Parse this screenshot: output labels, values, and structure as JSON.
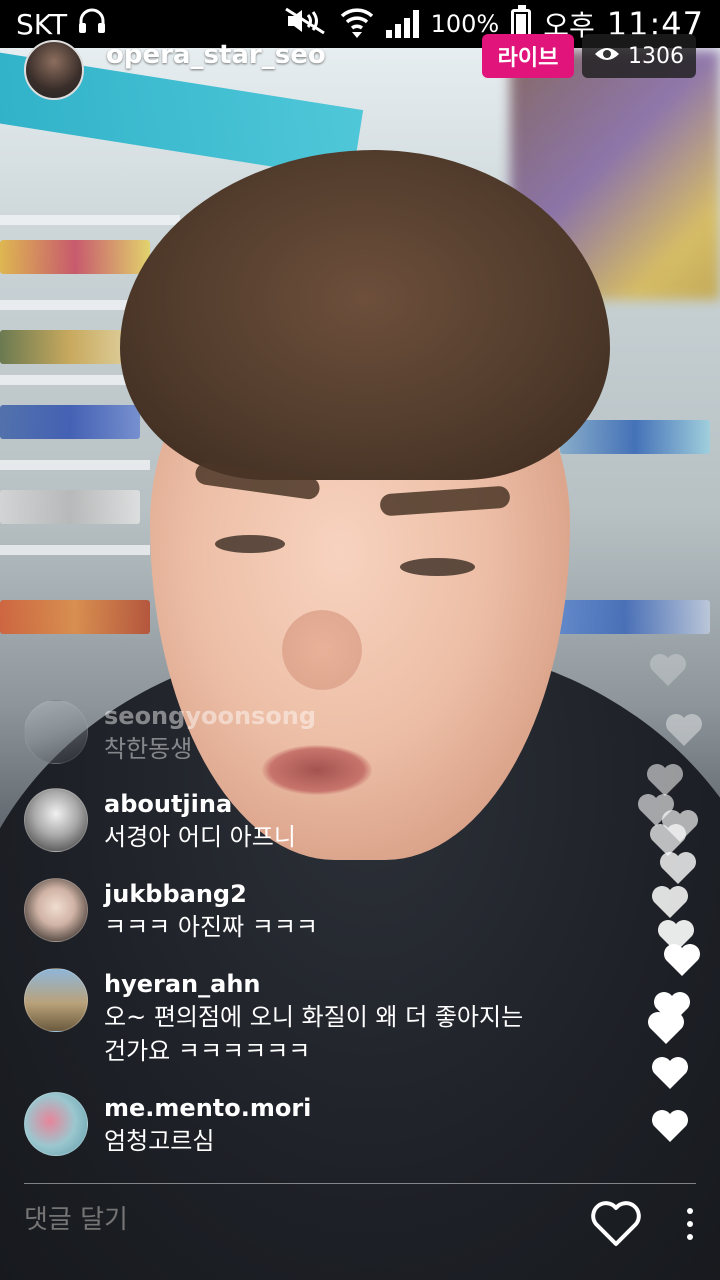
{
  "status_bar": {
    "carrier": "SKT",
    "battery_percent": "100%",
    "ampm": "오후",
    "time": "11:47"
  },
  "header": {
    "host_username": "opera_star_seo",
    "live_label": "라이브",
    "viewer_count": "1306"
  },
  "comments": [
    {
      "username": "seongyoonsong",
      "text": "착한동생"
    },
    {
      "username": "aboutjina",
      "text": "서경아 어디 아프니"
    },
    {
      "username": "jukbbang2",
      "text": "ㅋㅋㅋ 아진짜 ㅋㅋㅋ"
    },
    {
      "username": "hyeran_ahn",
      "text": "오~ 편의점에 오니 화질이 왜 더 좋아지는\n건가요 ㅋㅋㅋㅋㅋㅋ"
    },
    {
      "username": "me.mento.mori",
      "text": "엄청고르심"
    }
  ],
  "bottom_bar": {
    "comment_placeholder": "댓글 달기"
  },
  "colors": {
    "live_badge": "#e0147a",
    "status_bar_bg": "#000000"
  },
  "icons": [
    "headphones-icon",
    "mute-icon",
    "wifi-icon",
    "signal-icon",
    "battery-icon",
    "eye-icon",
    "heart-icon",
    "more-vertical-icon"
  ]
}
